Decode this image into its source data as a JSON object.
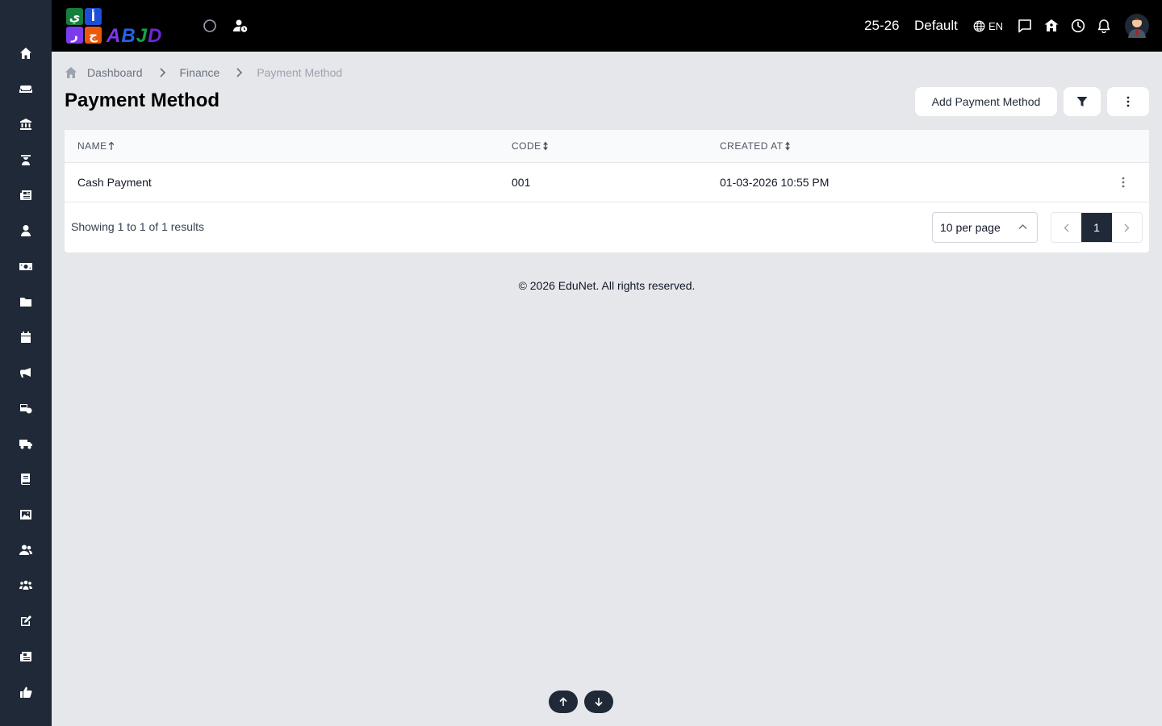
{
  "app": {
    "logo_word": "ABJD",
    "logo_tiles": [
      "ي",
      "أ",
      "ر",
      "ج"
    ],
    "colors": {
      "sidebar": "#1f2937",
      "topbar": "#000000",
      "background": "#e5e7eb",
      "active_page": "#1f2937",
      "logo_green": "#15803d",
      "logo_blue": "#1d4ed8",
      "logo_purple": "#7c3aed",
      "logo_orange": "#ea580c"
    }
  },
  "sidebar": {
    "items": [
      {
        "icon": "home-icon"
      },
      {
        "icon": "sofa-icon"
      },
      {
        "icon": "institution-icon"
      },
      {
        "icon": "teacher-icon"
      },
      {
        "icon": "newspaper-icon"
      },
      {
        "icon": "user-tie-icon"
      },
      {
        "icon": "money-icon"
      },
      {
        "icon": "folder-icon"
      },
      {
        "icon": "calendar-icon"
      },
      {
        "icon": "megaphone-icon"
      },
      {
        "icon": "bus-settings-icon"
      },
      {
        "icon": "truck-icon"
      },
      {
        "icon": "book-icon"
      },
      {
        "icon": "image-icon"
      },
      {
        "icon": "users-icon"
      },
      {
        "icon": "people-group-icon"
      },
      {
        "icon": "edit-icon"
      },
      {
        "icon": "reports-icon"
      },
      {
        "icon": "thumbs-up-icon"
      }
    ]
  },
  "topbar": {
    "session": "25-26",
    "profile": "Default",
    "language": "EN",
    "icons": [
      "circle-icon",
      "user-clock-icon",
      "globe-icon",
      "message-icon",
      "school-icon",
      "clock-icon",
      "bell-icon",
      "avatar"
    ]
  },
  "breadcrumb": {
    "items": [
      "Dashboard",
      "Finance",
      "Payment Method"
    ]
  },
  "page": {
    "title": "Payment Method",
    "add_button": "Add Payment Method"
  },
  "table": {
    "columns": [
      "NAME",
      "CODE",
      "CREATED AT"
    ],
    "rows": [
      {
        "name": "Cash Payment",
        "code": "001",
        "created_at": "01-03-2026 10:55 PM"
      }
    ],
    "showing": "Showing 1 to 1 of 1 results",
    "per_page": "10 per page",
    "current_page": "1"
  },
  "footer": {
    "text": "© 2026 EduNet. All rights reserved."
  }
}
